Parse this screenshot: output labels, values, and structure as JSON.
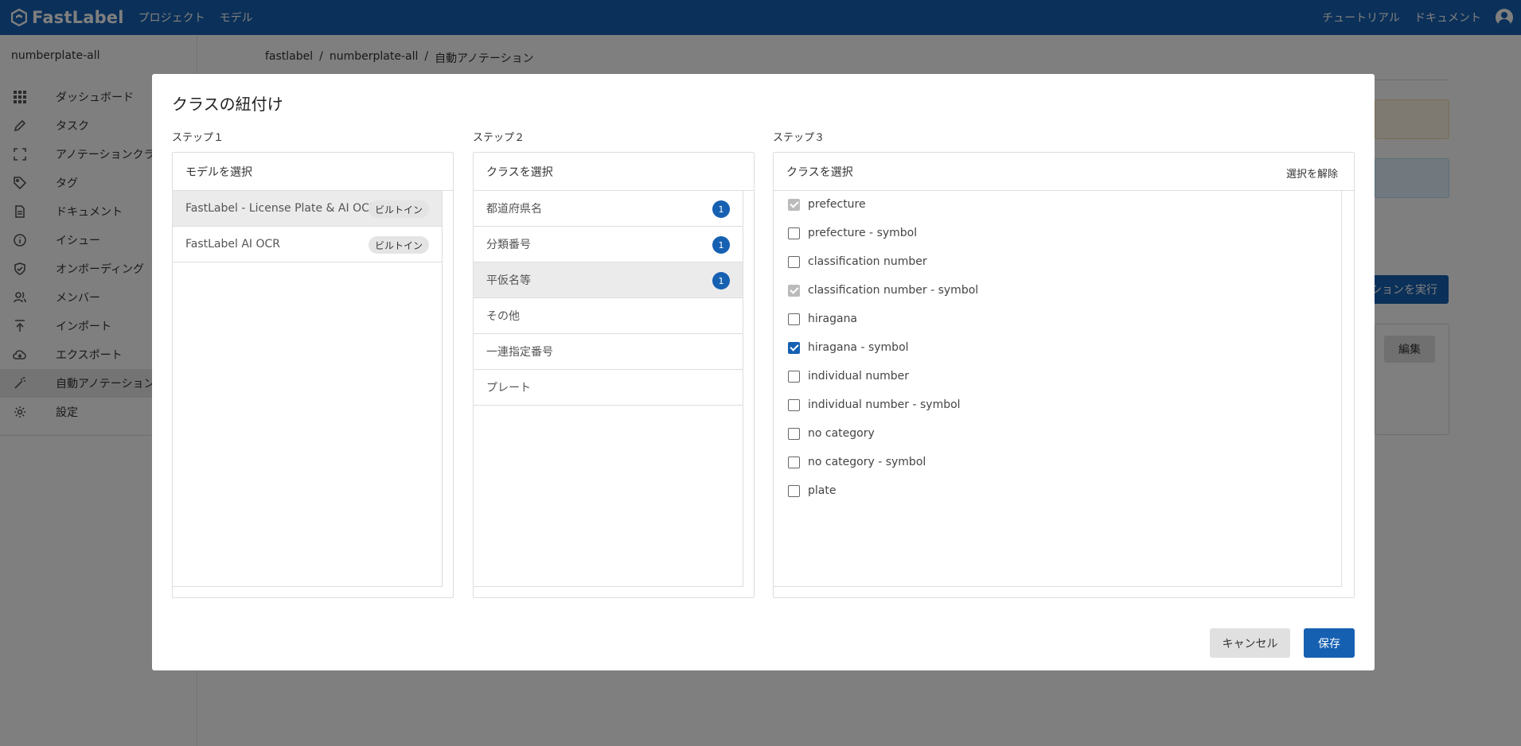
{
  "app": {
    "logo_text": "FastLabel"
  },
  "topnav": {
    "items": [
      "プロジェクト",
      "モデル"
    ]
  },
  "topright": {
    "tutorial": "チュートリアル",
    "docs": "ドキュメント"
  },
  "sidebar": {
    "project_name": "numberplate-all",
    "items": [
      {
        "label": "ダッシュボード",
        "icon": "grid-icon"
      },
      {
        "label": "タスク",
        "icon": "pencil-icon"
      },
      {
        "label": "アノテーションクラス",
        "icon": "frame-icon"
      },
      {
        "label": "タグ",
        "icon": "tag-icon"
      },
      {
        "label": "ドキュメント",
        "icon": "document-icon"
      },
      {
        "label": "イシュー",
        "icon": "info-icon"
      },
      {
        "label": "オンボーディング",
        "icon": "shield-check-icon"
      },
      {
        "label": "メンバー",
        "icon": "people-icon"
      },
      {
        "label": "インポート",
        "icon": "upload-icon"
      },
      {
        "label": "エクスポート",
        "icon": "cloud-download-icon"
      },
      {
        "label": "自動アノテーション",
        "icon": "magic-wand-icon"
      },
      {
        "label": "設定",
        "icon": "gear-icon"
      }
    ]
  },
  "breadcrumb": [
    "fastlabel",
    "/",
    "numberplate-all",
    "/",
    "自動アノテーション"
  ],
  "background": {
    "run_button": "ションを実行",
    "edit_button": "編集"
  },
  "modal": {
    "title": "クラスの紐付け",
    "step1": {
      "label": "ステップ１",
      "header": "モデルを選択",
      "models": [
        {
          "name": "FastLabel - License Plate & AI OCR",
          "tag": "ビルトイン"
        },
        {
          "name": "FastLabel AI OCR",
          "tag": "ビルトイン"
        }
      ]
    },
    "step2": {
      "label": "ステップ２",
      "header": "クラスを選択",
      "classes": [
        {
          "name": "都道府県名",
          "count": "1"
        },
        {
          "name": "分類番号",
          "count": "1"
        },
        {
          "name": "平仮名等",
          "count": "1"
        },
        {
          "name": "その他",
          "count": null
        },
        {
          "name": "一連指定番号",
          "count": null
        },
        {
          "name": "プレート",
          "count": null
        }
      ]
    },
    "step3": {
      "label": "ステップ３",
      "header": "クラスを選択",
      "deselect": "選択を解除",
      "options": [
        {
          "label": "prefecture",
          "state": "disabled"
        },
        {
          "label": "prefecture - symbol",
          "state": "unchecked"
        },
        {
          "label": "classification number",
          "state": "unchecked"
        },
        {
          "label": "classification number - symbol",
          "state": "disabled"
        },
        {
          "label": "hiragana",
          "state": "unchecked"
        },
        {
          "label": "hiragana - symbol",
          "state": "checked"
        },
        {
          "label": "individual number",
          "state": "unchecked"
        },
        {
          "label": "individual number - symbol",
          "state": "unchecked"
        },
        {
          "label": "no category",
          "state": "unchecked"
        },
        {
          "label": "no category - symbol",
          "state": "unchecked"
        },
        {
          "label": "plate",
          "state": "unchecked"
        }
      ]
    },
    "cancel": "キャンセル",
    "save": "保存"
  },
  "colors": {
    "brand": "#1660b2",
    "overlay": "rgba(0,0,0,0.5)"
  }
}
